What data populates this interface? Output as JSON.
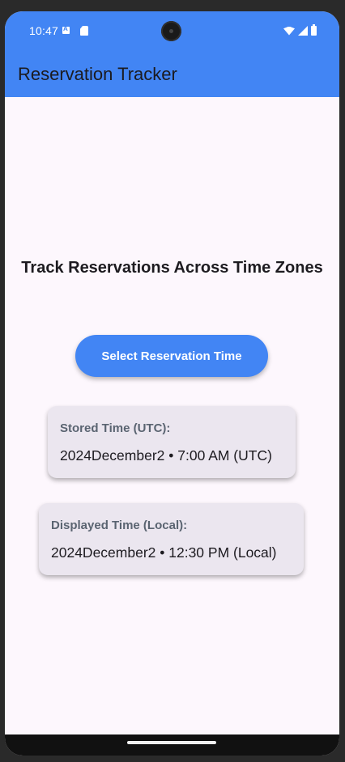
{
  "status_bar": {
    "time": "10:47",
    "icons": [
      "a-notification-icon",
      "sd-card-icon",
      "wifi-icon",
      "signal-icon",
      "battery-icon"
    ]
  },
  "app_bar": {
    "title": "Reservation Tracker",
    "color": "#4285f4"
  },
  "main": {
    "heading": "Track Reservations Across Time Zones",
    "select_button_label": "Select Reservation Time",
    "stored_card": {
      "label": "Stored Time (UTC):",
      "value": "2024December2 • 7:00 AM (UTC)"
    },
    "displayed_card": {
      "label": "Displayed Time (Local):",
      "value": "2024December2 • 12:30 PM (Local)"
    }
  },
  "colors": {
    "accent": "#4285f4",
    "background": "#fdf7fd",
    "card": "#ebe6ef",
    "label_text": "#5a6471"
  }
}
